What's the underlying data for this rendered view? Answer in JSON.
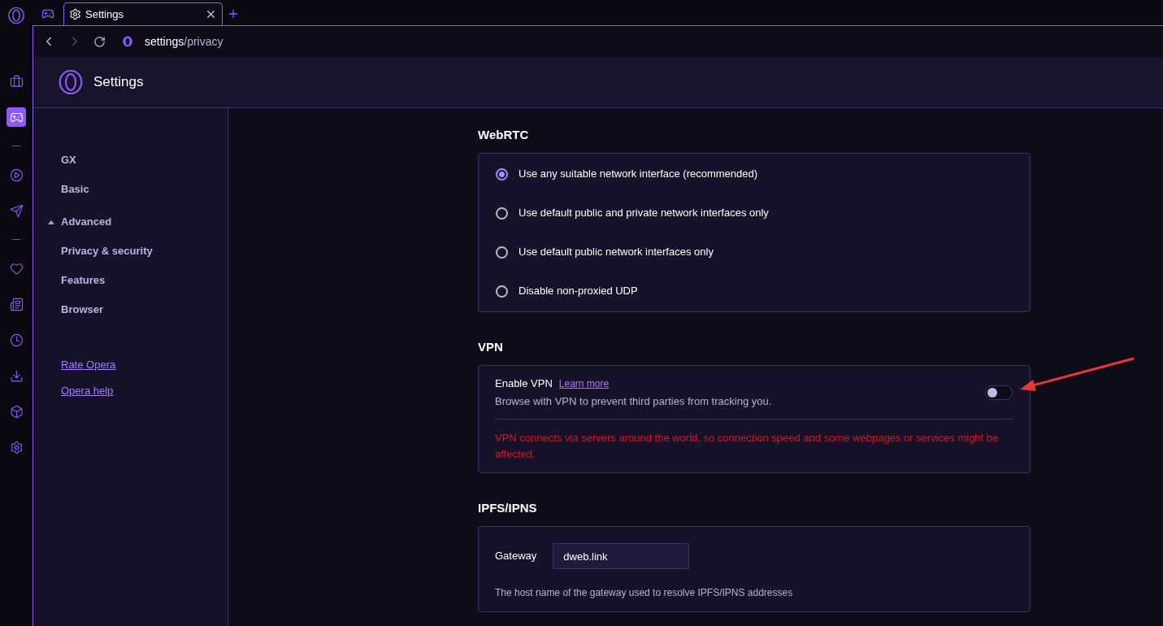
{
  "rail_items": [
    {
      "selected": false
    },
    {
      "selected": true
    },
    {
      "selected": false
    },
    {
      "selected": false
    },
    {
      "selected": false
    },
    {
      "selected": false
    },
    {
      "selected": false
    },
    {
      "selected": false
    },
    {
      "selected": false
    },
    {
      "selected": false
    }
  ],
  "tabs": [
    {
      "selected": false
    },
    {
      "label": "Settings",
      "selected": true
    }
  ],
  "address_bar": {
    "host": "settings",
    "path": "/privacy"
  },
  "page_title": "Settings",
  "sidebar": {
    "items": [
      {
        "label": "GX",
        "kind": "top"
      },
      {
        "label": "Basic",
        "kind": "top"
      },
      {
        "label": "Advanced",
        "kind": "group",
        "expanded": true,
        "children": [
          {
            "label": "Privacy & security"
          },
          {
            "label": "Features"
          },
          {
            "label": "Browser"
          }
        ]
      }
    ],
    "links": [
      "Rate Opera",
      "Opera help"
    ]
  },
  "webrtc": {
    "heading": "WebRTC",
    "options": [
      {
        "label": "Use any suitable network interface (recommended)",
        "selected": true
      },
      {
        "label": "Use default public and private network interfaces only",
        "selected": false
      },
      {
        "label": "Use default public network interfaces only",
        "selected": false
      },
      {
        "label": "Disable non-proxied UDP",
        "selected": false
      }
    ]
  },
  "vpn": {
    "heading": "VPN",
    "title": "Enable VPN",
    "link": "Learn more",
    "description": "Browse with VPN to prevent third parties from tracking you.",
    "on": false,
    "warning": "VPN connects via servers around the world, so connection speed and some webpages or services might be affected."
  },
  "ipfs": {
    "heading": "IPFS/IPNS",
    "label": "Gateway",
    "value": "dweb.link",
    "description": "The host name of the gateway used to resolve IPFS/IPNS addresses"
  }
}
